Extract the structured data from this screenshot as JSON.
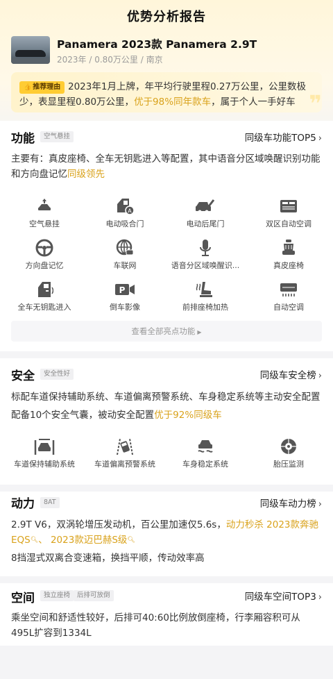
{
  "header": {
    "title": "优势分析报告"
  },
  "car": {
    "name": "Panamera 2023款 Panamera 2.9T",
    "meta": "2023年 / 0.80万公里 / 南京"
  },
  "reason": {
    "tag": "推荐理由",
    "text_plain": "2023年1月上牌，年平均行驶里程0.27万公里，公里数极少，表显里程0.80万公里，",
    "text_highlight": "优于98%同年款车",
    "text_tail": "，属于个人一手好车"
  },
  "function": {
    "title": "功能",
    "chip": "空气悬挂",
    "rank_link": "同级车功能TOP5",
    "desc_plain": "主要有：真皮座椅、全车无钥匙进入等配置，其中语音分区域唤醒识别功能和方向盘记忆",
    "desc_highlight": "同级领先",
    "items": [
      {
        "label": "空气悬挂",
        "icon": "air-suspension-icon"
      },
      {
        "label": "电动吸合门",
        "icon": "soft-close-door-icon"
      },
      {
        "label": "电动后尾门",
        "icon": "power-tailgate-icon"
      },
      {
        "label": "双区自动空调",
        "icon": "dual-zone-ac-icon"
      },
      {
        "label": "方向盘记忆",
        "icon": "steering-memory-icon"
      },
      {
        "label": "车联网",
        "icon": "connected-car-icon"
      },
      {
        "label": "语音分区域唤醒识...",
        "icon": "voice-wake-icon"
      },
      {
        "label": "真皮座椅",
        "icon": "leather-seat-icon"
      },
      {
        "label": "全车无钥匙进入",
        "icon": "keyless-entry-icon"
      },
      {
        "label": "倒车影像",
        "icon": "reverse-camera-icon"
      },
      {
        "label": "前排座椅加热",
        "icon": "seat-heating-icon"
      },
      {
        "label": "自动空调",
        "icon": "auto-ac-icon"
      }
    ],
    "view_all": "查看全部亮点功能"
  },
  "safety": {
    "title": "安全",
    "chip": "安全性好",
    "rank_link": "同级车安全榜",
    "desc_line1": "标配车道保持辅助系统、车道偏离预警系统、车身稳定系统等主动安全配置",
    "desc_line2_plain": "配备10个安全气囊，被动安全配置",
    "desc_line2_highlight": "优于92%同级车",
    "items": [
      {
        "label": "车道保持辅助系统",
        "icon": "lane-keep-icon"
      },
      {
        "label": "车道偏离预警系统",
        "icon": "lane-departure-icon"
      },
      {
        "label": "车身稳定系统",
        "icon": "stability-control-icon"
      },
      {
        "label": "胎压监测",
        "icon": "tire-pressure-icon"
      }
    ]
  },
  "power": {
    "title": "动力",
    "chip": "8AT",
    "rank_link": "同级车动力榜",
    "desc_plain": "2.9T V6，双涡轮增压发动机，百公里加速仅5.6s，",
    "desc_highlight": "动力秒杀",
    "compare1": "2023款奔驰EQS",
    "compare_sep": "、",
    "compare2": "2023款迈巴赫S级",
    "desc_line2": "8挡湿式双离合变速箱，换挡平顺，传动效率高"
  },
  "space": {
    "title": "空间",
    "chip1": "独立座椅",
    "chip2": "后排可放倒",
    "rank_link": "同级车空间TOP3",
    "desc": "乘坐空间和舒适性较好，后排可40:60比例放倒座椅，行李厢容积可从495L扩容到1334L"
  },
  "colors": {
    "accent": "#d9a21b",
    "tag_bg": "#ffcc33"
  }
}
